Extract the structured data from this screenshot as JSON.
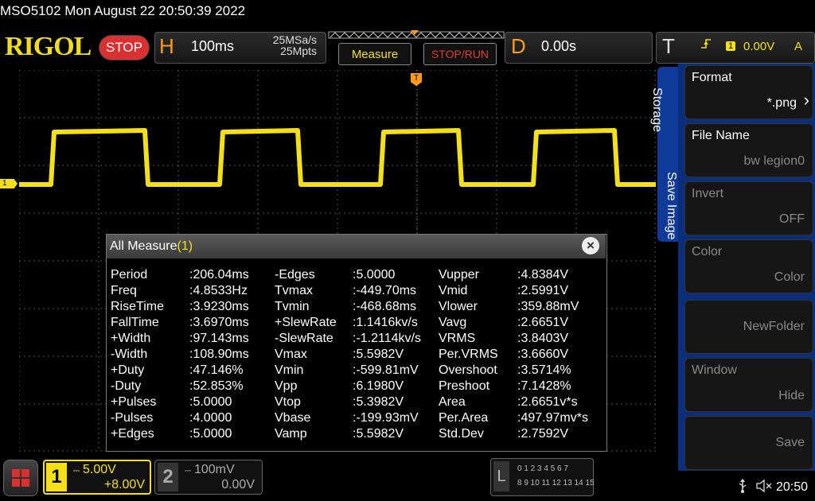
{
  "header": {
    "title": "MSO5102  Mon August 22 20:50:39 2022",
    "logo": "RIGOL",
    "run_state": "STOP",
    "horizontal": {
      "letter": "H",
      "timebase": "100ms",
      "sample_rate": "25MSa/s",
      "memory_depth": "25Mpts"
    },
    "measure_button": "Measure",
    "stop_run_button": "STOP/RUN",
    "delay": {
      "letter": "D",
      "value": "0.00s"
    },
    "trigger": {
      "letter": "T",
      "edge_icon": "rising-edge-icon",
      "channel": "1",
      "level": "0.00V",
      "mode": "A"
    }
  },
  "markers": {
    "ch1": "1",
    "trigger": "T"
  },
  "measure_panel": {
    "title": "All Measure",
    "channel": "(1)",
    "columns": [
      [
        [
          "Period",
          ":206.04ms"
        ],
        [
          "Freq",
          ":4.8533Hz"
        ],
        [
          "RiseTime",
          ":3.9230ms"
        ],
        [
          "FallTime",
          ":3.6970ms"
        ],
        [
          "+Width",
          ":97.143ms"
        ],
        [
          "-Width",
          ":108.90ms"
        ],
        [
          "+Duty",
          ":47.146%"
        ],
        [
          "-Duty",
          ":52.853%"
        ],
        [
          "+Pulses",
          ":5.0000"
        ],
        [
          "-Pulses",
          ":4.0000"
        ],
        [
          "+Edges",
          ":5.0000"
        ]
      ],
      [
        [
          "-Edges",
          ":5.0000"
        ],
        [
          "Tvmax",
          ":-449.70ms"
        ],
        [
          "Tvmin",
          ":-468.68ms"
        ],
        [
          "+SlewRate",
          ":1.1416kv/s"
        ],
        [
          "-SlewRate",
          ":-1.2114kv/s"
        ],
        [
          "Vmax",
          ":5.5982V"
        ],
        [
          "Vmin",
          ":-599.81mV"
        ],
        [
          "Vpp",
          ":6.1980V"
        ],
        [
          "Vtop",
          ":5.3982V"
        ],
        [
          "Vbase",
          ":-199.93mV"
        ],
        [
          "Vamp",
          ":5.5982V"
        ]
      ],
      [
        [
          "Vupper",
          ":4.8384V"
        ],
        [
          "Vmid",
          ":2.5991V"
        ],
        [
          "Vlower",
          ":359.88mV"
        ],
        [
          "Vavg",
          ":2.6651V"
        ],
        [
          "VRMS",
          ":3.8403V"
        ],
        [
          "Per.VRMS",
          ":3.6660V"
        ],
        [
          "Overshoot",
          ":3.5714%"
        ],
        [
          "Preshoot",
          ":7.1428%"
        ],
        [
          "Area",
          ":2.6651v*s"
        ],
        [
          "Per.Area",
          ":497.97mv*s"
        ],
        [
          "Std.Dev",
          ":2.7592V"
        ]
      ]
    ]
  },
  "side_menu": {
    "tabs": [
      "Storage",
      "Save Image"
    ],
    "items": [
      {
        "label": "Format",
        "value": "*.png"
      },
      {
        "label": "File Name",
        "value": "bw legion0"
      },
      {
        "label": "Invert",
        "value": "OFF"
      },
      {
        "label": "Color",
        "value": "Color"
      },
      {
        "label": "",
        "value": "NewFolder"
      },
      {
        "label": "Window",
        "value": "Hide"
      },
      {
        "label": "",
        "value": "Save"
      }
    ]
  },
  "bottom": {
    "ch1": {
      "num": "1",
      "scale": "5.00V",
      "offset": "+8.00V"
    },
    "ch2": {
      "num": "2",
      "scale": "100mV",
      "offset": "0.00V"
    },
    "la": {
      "letter": "L",
      "row1": "0 1 2 3  4 5 6 7",
      "row2": "8 9 10 11 12 13 14 15"
    },
    "clock": "20:50"
  },
  "colors": {
    "ch1": "#f5e017",
    "accent": "#ff9a1a",
    "menu": "#0b2e7a",
    "stop": "#d8312f"
  }
}
